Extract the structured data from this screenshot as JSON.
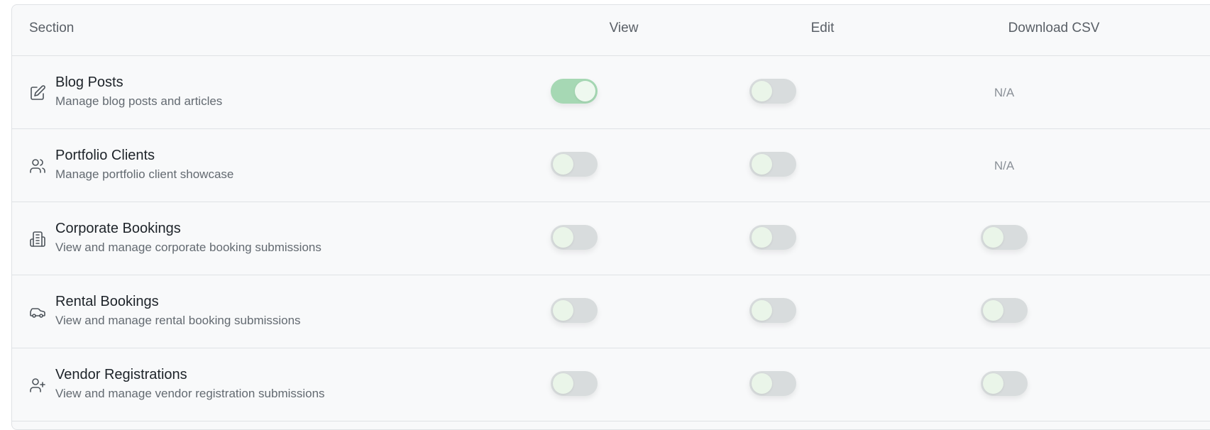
{
  "table": {
    "columns": {
      "section": "Section",
      "view": "View",
      "edit": "Edit",
      "download": "Download CSV"
    },
    "rows": [
      {
        "icon": "edit-icon",
        "title": "Blog Posts",
        "description": "Manage blog posts and articles",
        "view": true,
        "edit": false,
        "download": "N/A"
      },
      {
        "icon": "users-icon",
        "title": "Portfolio Clients",
        "description": "Manage portfolio client showcase",
        "view": false,
        "edit": false,
        "download": "N/A"
      },
      {
        "icon": "building-icon",
        "title": "Corporate Bookings",
        "description": "View and manage corporate booking submissions",
        "view": false,
        "edit": false,
        "download": false
      },
      {
        "icon": "car-icon",
        "title": "Rental Bookings",
        "description": "View and manage rental booking submissions",
        "view": false,
        "edit": false,
        "download": false
      },
      {
        "icon": "user-plus-icon",
        "title": "Vendor Registrations",
        "description": "View and manage vendor registration submissions",
        "view": false,
        "edit": false,
        "download": false
      }
    ]
  },
  "colors": {
    "toggle_on": "#a6d8b4",
    "toggle_off": "#d8dcdd",
    "knob": "#eaf5e9"
  }
}
